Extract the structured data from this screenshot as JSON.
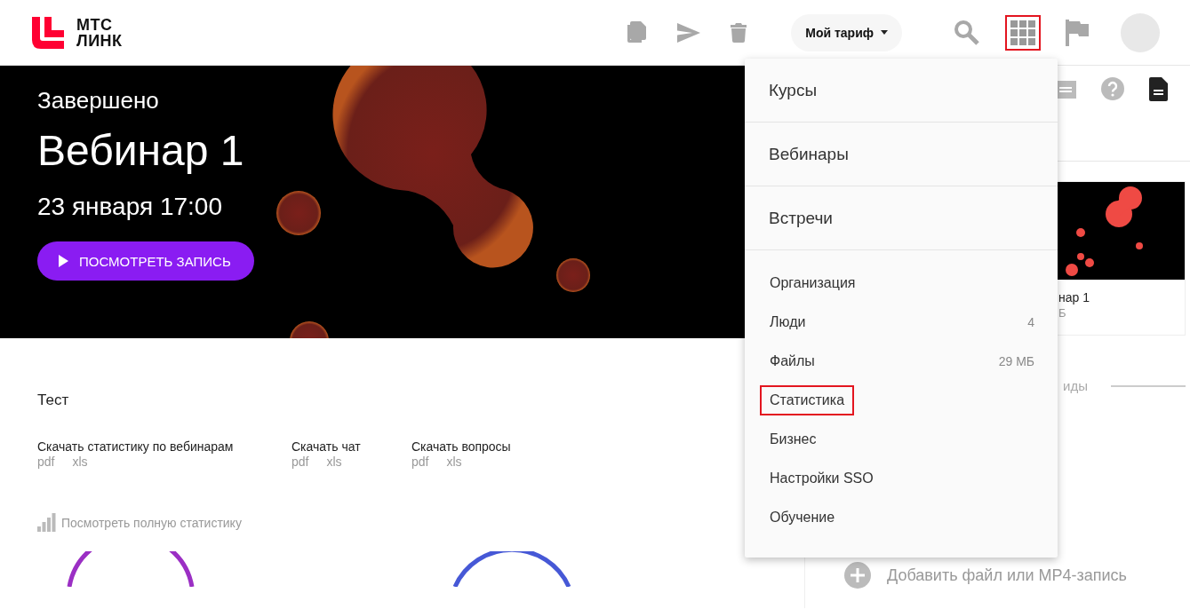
{
  "logo": {
    "line1": "МТС",
    "line2": "ЛИНК"
  },
  "toolbar": {
    "tariff_button": "Мой тариф",
    "apps_highlighted": true
  },
  "hero": {
    "status": "Завершено",
    "title": "Вебинар 1",
    "date": "23 января 17:00",
    "button": "ПОСМОТРЕТЬ ЗАПИСЬ"
  },
  "section_title": "Тест",
  "downloads": [
    {
      "label": "Скачать статистику по вебинарам",
      "links": [
        "pdf",
        "xls"
      ]
    },
    {
      "label": "Скачать чат",
      "links": [
        "pdf",
        "xls"
      ]
    },
    {
      "label": "Скачать вопросы",
      "links": [
        "pdf",
        "xls"
      ]
    }
  ],
  "full_stats_link": "Посмотреть полную статистику",
  "side_panel": {
    "card_title": "нар 1",
    "card_meta": "Б",
    "section_label": "иды",
    "add_file": "Добавить файл или MP4-запись"
  },
  "menu": [
    {
      "kind": "large",
      "label": "Курсы",
      "highlighted": false
    },
    {
      "kind": "large",
      "label": "Вебинары",
      "highlighted": false
    },
    {
      "kind": "large",
      "label": "Встречи",
      "highlighted": false
    },
    {
      "kind": "small",
      "label": "Организация",
      "highlighted": false
    },
    {
      "kind": "small",
      "label": "Люди",
      "count": "4",
      "highlighted": false
    },
    {
      "kind": "small",
      "label": "Файлы",
      "count": "29 МБ",
      "highlighted": false
    },
    {
      "kind": "small",
      "label": "Статистика",
      "highlighted": true
    },
    {
      "kind": "small",
      "label": "Бизнес",
      "highlighted": false
    },
    {
      "kind": "small",
      "label": "Настройки SSO",
      "highlighted": false
    },
    {
      "kind": "small",
      "label": "Обучение",
      "highlighted": false
    }
  ]
}
